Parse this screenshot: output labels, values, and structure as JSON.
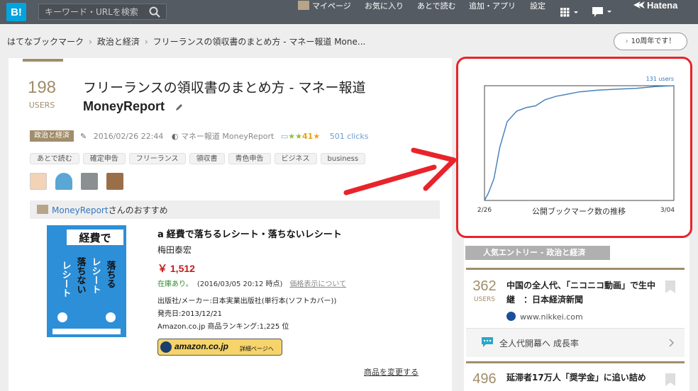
{
  "header": {
    "logo": "B!",
    "search_placeholder": "キーワード・URLを検索",
    "nav": {
      "mypage": "マイページ",
      "favorites": "お気に入り",
      "read_later": "あとで読む",
      "add_app": "追加・アプリ",
      "settings": "設定",
      "hatena": "Hatena"
    }
  },
  "breadcrumb": [
    "はてなブックマーク",
    "政治と経済",
    "フリーランスの領収書のまとめ方 - マネー報道 Mone..."
  ],
  "anniversary_button": "10周年です！",
  "entry": {
    "count": "198",
    "users_label": "USERS",
    "title": "フリーランスの領収書のまとめ方 - マネー報道",
    "site_name": "MoneyReport",
    "category": "政治と経済",
    "date": "2016/02/26 22:44",
    "source": "マネー報道 MoneyReport",
    "star_count": "41",
    "clicks": "501 clicks",
    "tags": [
      "あとで読む",
      "確定申告",
      "フリーランス",
      "領収書",
      "青色申告",
      "ビジネス",
      "business"
    ]
  },
  "recommend": {
    "user": "MoneyReport",
    "suffix": "さんのおすすめ"
  },
  "book": {
    "cover_text": [
      "経費で",
      "落ちる",
      "レシート",
      "落ちない",
      "レシート"
    ],
    "title": "経費で落ちるレシート・落ちないレシート",
    "author": "梅田泰宏",
    "price": "￥ 1,512",
    "stock": "在庫あり。",
    "stock_date": "(2016/03/05 20:12 時点)",
    "price_note": "価格表示について",
    "publisher": "出版社/メーカー:日本実業出版社(単行本(ソフトカバー))",
    "release": "発売日:2013/12/21",
    "rank": "Amazon.co.jp 商品ランキング:1,225 位",
    "amazon_button": "amazon.co.jp",
    "amazon_detail": "詳細ページへ",
    "change_link": "商品を変更する"
  },
  "chart_data": {
    "type": "line",
    "title": "公開ブックマーク数の推移",
    "x_start_label": "2/26",
    "x_end_label": "3/04",
    "max_label": "131 users",
    "x": [
      0,
      0.02,
      0.05,
      0.08,
      0.12,
      0.17,
      0.22,
      0.27,
      0.32,
      0.38,
      0.43,
      0.5,
      0.6,
      0.7,
      0.8,
      0.9,
      1.0
    ],
    "values": [
      0,
      8,
      25,
      60,
      90,
      102,
      106,
      108,
      115,
      119,
      121,
      124,
      126,
      127,
      128,
      130,
      131
    ],
    "ylim": [
      0,
      131
    ],
    "color": "#4a82bd"
  },
  "popular": {
    "heading": "人気エントリー - 政治と経済",
    "entry1": {
      "count": "362",
      "users_label": "USERS",
      "title": "中国の全人代、「ニコニコ動画」で生中継　：日本経済新聞",
      "site": "www.nikkei.com"
    },
    "related": "全人代開幕へ 成長率",
    "entry2": {
      "count": "496",
      "title": "延滞者17万人「奨学金」に追い詰め"
    }
  },
  "colors": {
    "accent": "#a18d6b",
    "header": "#555b62",
    "annotation": "#e8242a"
  }
}
